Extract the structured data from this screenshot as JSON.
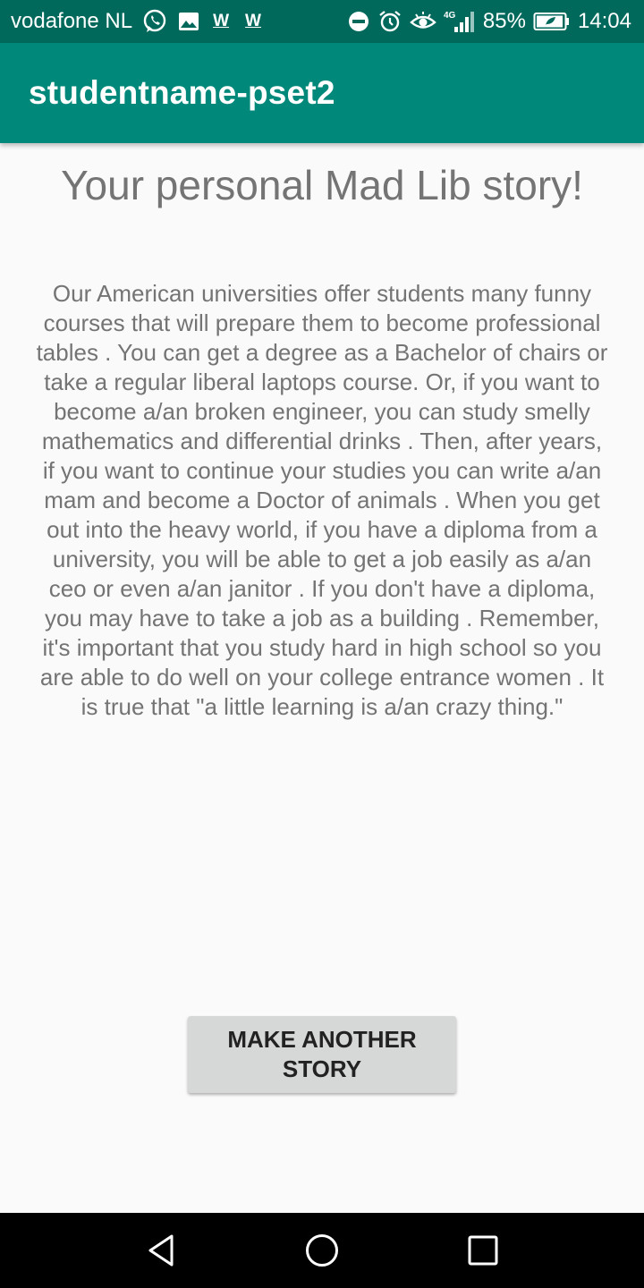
{
  "status_bar": {
    "carrier": "vodafone NL",
    "notification_icons": [
      "whatsapp-icon",
      "gallery-icon",
      "w-icon",
      "w-icon"
    ],
    "w1": "W",
    "w2": "W",
    "system_icons": [
      "do-not-disturb-icon",
      "alarm-icon",
      "eye-icon",
      "signal-4g-icon",
      "battery-icon"
    ],
    "network": "4G",
    "battery": "85%",
    "time": "14:04"
  },
  "app_bar": {
    "title": "studentname-pset2"
  },
  "main": {
    "heading": "Your personal Mad Lib story!",
    "story": "Our American universities offer students many funny courses that will prepare them to become professional tables . You can get a degree as a Bachelor of chairs or take a regular liberal laptops course. Or, if you want to become a/an broken engineer, you can study smelly mathematics and differential drinks . Then, after  years, if you want to continue your studies you can write a/an mam and become a Doctor of animals . When you get out into the heavy world, if you have a diploma from a university, you will be able to get a job easily as a/an ceo or even a/an janitor . If you don't have a diploma, you may have to take a job as a building . Remember, it's important that you study hard in high school so you are able to do well on your college entrance women . It is true that \"a little learning is a/an crazy thing.\"",
    "button_label": "MAKE ANOTHER STORY"
  },
  "nav_bar": {
    "icons": [
      "back-icon",
      "home-icon",
      "recents-icon"
    ]
  },
  "colors": {
    "status_bar": "#00695c",
    "app_bar": "#00897b",
    "background": "#fafafa",
    "text": "#747474",
    "button": "#d6d7d7"
  }
}
